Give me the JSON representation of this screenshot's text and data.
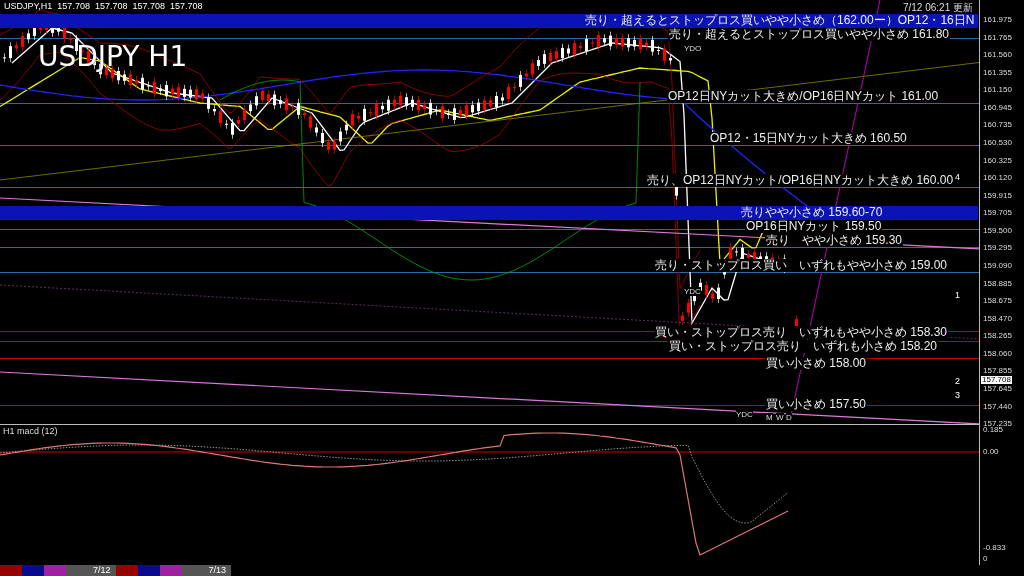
{
  "header": {
    "symbol": "USDJPY,H1",
    "prices": [
      "157.708",
      "157.708",
      "157.708",
      "157.708"
    ]
  },
  "updated": "7/12 06:21 更新",
  "title": "USDJPY H1",
  "levels": [
    {
      "text": "売り・超えるとストップロス買いやや小さめ（162.00ー）OP12・16日N",
      "kind": "sell",
      "banded": true
    },
    {
      "text": "売り・超えるとストップロス買いやや小さめ 161.80",
      "kind": "sell",
      "banded": false
    },
    {
      "text": "OP12日NYカット大きめ/OP16日NYカット 161.00",
      "kind": "sell",
      "banded": false
    },
    {
      "text": "OP12・15日NYカット大きめ 160.50",
      "kind": "sell",
      "banded": false
    },
    {
      "text": "売り、OP12日NYカット/OP16日NYカット大きめ 160.00",
      "kind": "sell",
      "banded": false
    },
    {
      "text": "売りやや小さめ 159.60-70",
      "kind": "sell",
      "banded": true
    },
    {
      "text": "OP16日NYカット 159.50",
      "kind": "sell",
      "banded": false
    },
    {
      "text": "売り　やや小さめ 159.30",
      "kind": "sell",
      "banded": false
    },
    {
      "text": "売り・ストップロス買い　いずれもやや小さめ 159.00",
      "kind": "sell",
      "banded": false
    },
    {
      "text": "買い・ストップロス売り　いずれもやや小さめ 158.30",
      "kind": "buy",
      "banded": false
    },
    {
      "text": "買い・ストップロス売り　いずれも小さめ 158.20",
      "kind": "buy",
      "banded": false
    },
    {
      "text": "買い小さめ 158.00",
      "kind": "buy",
      "banded": false
    },
    {
      "text": "買い小さめ 157.50",
      "kind": "buy",
      "banded": false
    }
  ],
  "wave_labels": [
    "4",
    "1",
    "2",
    "3"
  ],
  "tags": [
    "YDO",
    "YDC",
    "YDC",
    "M",
    "W",
    "D"
  ],
  "price_axis": {
    "ticks": [
      "161.975",
      "161.765",
      "161.560",
      "161.355",
      "161.150",
      "160.945",
      "160.735",
      "160.530",
      "160.325",
      "160.120",
      "159.915",
      "159.705",
      "159.500",
      "159.295",
      "159.090",
      "158.885",
      "158.675",
      "158.470",
      "158.265",
      "158.060",
      "157.855",
      "157.645",
      "157.440",
      "157.235"
    ],
    "current": "157.708"
  },
  "macd": {
    "label": "H1 macd (12)",
    "ticks": [
      "0.185",
      "0.00",
      "-0.833",
      "0"
    ]
  },
  "bottom_bar": {
    "dates": [
      "7/12",
      "7/13"
    ]
  }
}
